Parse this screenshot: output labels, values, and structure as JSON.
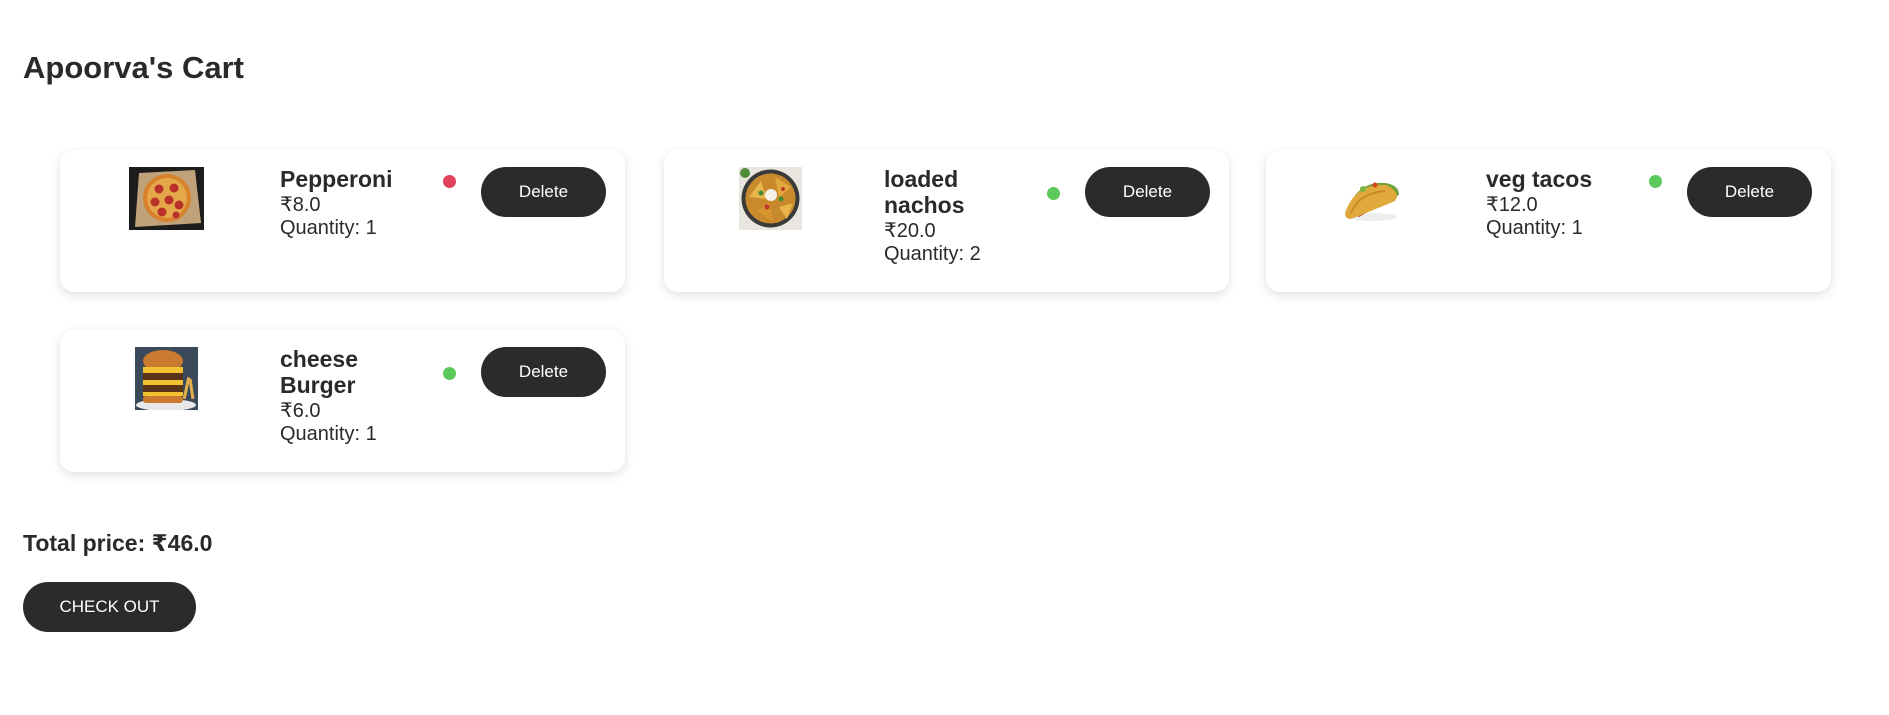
{
  "page_title": "Apoorva's Cart",
  "items": [
    {
      "name": "Pepperoni",
      "price": "₹8.0",
      "quantity": "Quantity: 1",
      "veg_status": "non-veg",
      "status_color": "#e0435c",
      "image": "pepperoni-pizza-image",
      "delete_label": "Delete"
    },
    {
      "name": "loaded nachos",
      "price": "₹20.0",
      "quantity": "Quantity: 2",
      "veg_status": "veg",
      "status_color": "#5cc95c",
      "image": "loaded-nachos-image",
      "delete_label": "Delete"
    },
    {
      "name": "veg tacos",
      "price": "₹12.0",
      "quantity": "Quantity: 1",
      "veg_status": "veg",
      "status_color": "#5cc95c",
      "image": "veg-tacos-image",
      "delete_label": "Delete"
    },
    {
      "name": "cheese Burger",
      "price": "₹6.0",
      "quantity": "Quantity: 1",
      "veg_status": "veg",
      "status_color": "#5cc95c",
      "image": "cheese-burger-image",
      "delete_label": "Delete"
    }
  ],
  "total": "Total price: ₹46.0",
  "checkout_label": "CHECK OUT",
  "colors": {
    "button_bg": "#2b2b2b",
    "button_text": "#ffffff",
    "veg": "#5cc95c",
    "non_veg": "#e0435c"
  }
}
